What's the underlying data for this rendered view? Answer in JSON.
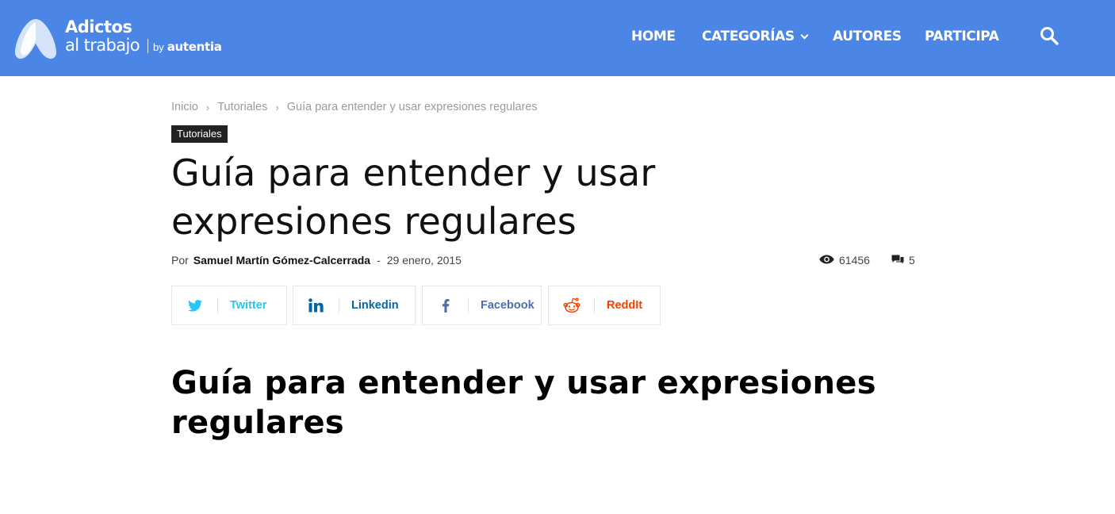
{
  "header": {
    "logo": {
      "line1": "Adictos",
      "line2": "al trabajo",
      "by": "by",
      "brand": "autentia"
    },
    "nav": [
      {
        "label": "HOME"
      },
      {
        "label": "CATEGORÍAS"
      },
      {
        "label": "AUTORES"
      },
      {
        "label": "PARTICIPA"
      }
    ],
    "search_icon": "search-icon",
    "background_color": "#4b86e6"
  },
  "breadcrumb": {
    "items": [
      "Inicio",
      "Tutoriales",
      "Guía para entender y usar expresiones regulares"
    ],
    "separator": "›"
  },
  "article": {
    "category": "Tutoriales",
    "title": "Guía para entender y usar expresiones regulares",
    "by_label": "Por",
    "author": "Samuel Martín Gómez-Calcerrada",
    "dash": "-",
    "date": "29 enero, 2015",
    "views": "61456",
    "comments": "5",
    "heading": "Guía para entender y usar expresiones regulares"
  },
  "share": [
    {
      "label": "Twitter",
      "icon": "twitter-icon",
      "color": "#29c5f6"
    },
    {
      "label": "Linkedin",
      "icon": "linkedin-icon",
      "color": "#0266a0"
    },
    {
      "label": "Facebook",
      "icon": "facebook-icon",
      "color": "#516eab"
    },
    {
      "label": "ReddIt",
      "icon": "reddit-icon",
      "color": "#f54200"
    }
  ]
}
